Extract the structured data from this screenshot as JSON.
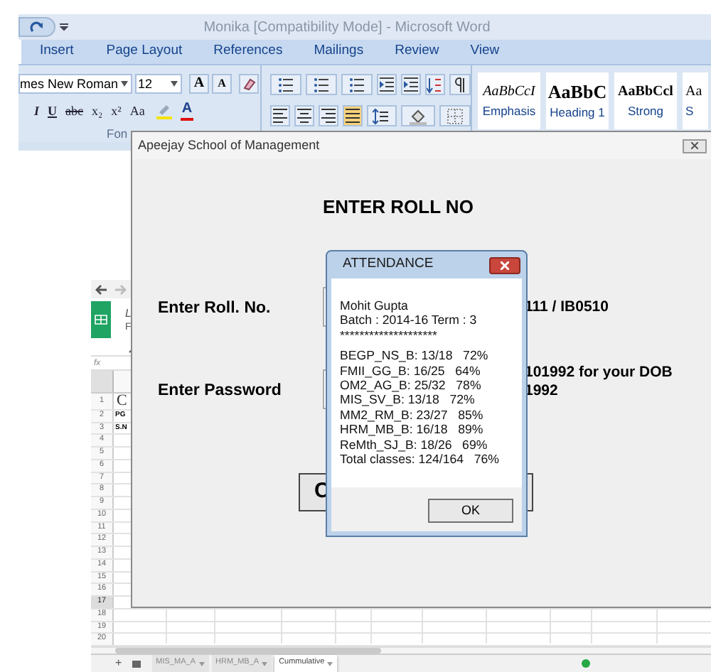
{
  "word": {
    "title": "Monika [Compatibility Mode] - Microsoft Word",
    "tabs": [
      "Insert",
      "Page Layout",
      "References",
      "Mailings",
      "Review",
      "View"
    ],
    "font_name": "mes New Roman",
    "font_size": "12",
    "grow_font": "A",
    "shrink_font": "A",
    "format_buttons": [
      "I",
      "U",
      "abc",
      "x₂",
      "x²",
      "Aa"
    ],
    "font_color": "A",
    "group_label": "Fon",
    "styles": [
      {
        "sample": "AaBbCcI",
        "label": "Emphasis",
        "kind": "italic"
      },
      {
        "sample": "AaBbC",
        "label": "Heading 1",
        "kind": "heading"
      },
      {
        "sample": "AaBbCcl",
        "label": "Strong",
        "kind": "bold"
      },
      {
        "sample": "Aa",
        "label": "S",
        "kind": "plain"
      }
    ]
  },
  "spreadsheet": {
    "title_letter": "L",
    "menu_letter": "F",
    "formula_label": "fx",
    "rows": [
      {
        "number": "1",
        "cell": "C",
        "kind": "title",
        "selected": false
      },
      {
        "number": "2",
        "cell": "PG",
        "kind": "small",
        "selected": false
      },
      {
        "number": "3",
        "cell": "S.N",
        "kind": "small",
        "selected": false
      },
      {
        "number": "4",
        "selected": false
      },
      {
        "number": "5",
        "selected": false
      },
      {
        "number": "6",
        "selected": false
      },
      {
        "number": "7",
        "selected": false
      },
      {
        "number": "8",
        "selected": false
      },
      {
        "number": "9",
        "selected": false
      },
      {
        "number": "10",
        "selected": false
      },
      {
        "number": "11",
        "selected": false
      },
      {
        "number": "12",
        "selected": false
      },
      {
        "number": "13",
        "selected": false
      },
      {
        "number": "14",
        "selected": false
      },
      {
        "number": "15",
        "selected": false
      },
      {
        "number": "16",
        "selected": false
      },
      {
        "number": "17",
        "selected": true
      },
      {
        "number": "18",
        "selected": false
      },
      {
        "number": "19",
        "selected": false
      },
      {
        "number": "20",
        "selected": false
      }
    ],
    "add_sheet": "+",
    "sheets": [
      {
        "label": "MIS_MA_A",
        "selected": false
      },
      {
        "label": "HRM_MB_A",
        "selected": false
      },
      {
        "label": "Cummulative",
        "selected": true
      }
    ]
  },
  "dialog": {
    "title": "Apeejay School of Management",
    "heading": "ENTER ROLL NO",
    "fields": [
      {
        "label": "Enter Roll. No.",
        "hints": [
          "111 / IB0510"
        ]
      },
      {
        "label": "Enter Password",
        "hints": [
          "101992 for your DOB",
          "1992"
        ]
      }
    ],
    "button": "C"
  },
  "message_box": {
    "title": "ATTENDANCE",
    "lines": [
      "Mohit Gupta",
      "Batch : 2014-16 Term : 3",
      "********************",
      "BEGP_NS_B: 13/18   72%",
      "FMII_GG_B: 16/25   64%",
      "OM2_AG_B: 25/32   78%",
      "MIS_SV_B: 13/18   72%",
      "MM2_RM_B: 23/27   85%",
      "HRM_MB_B: 16/18   89%",
      "ReMth_SJ_B: 18/26   69%",
      "Total classes: 124/164   76%"
    ],
    "button": "OK"
  }
}
